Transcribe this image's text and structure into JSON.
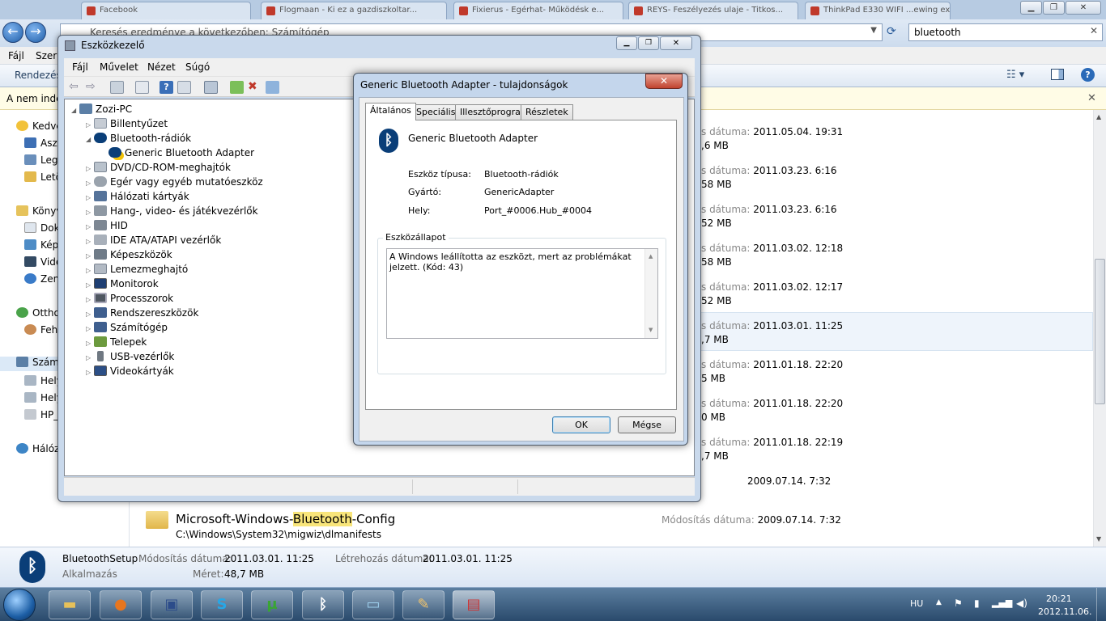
{
  "browser_tabs": [
    "Facebook",
    "Flogmaan - Ki ez a gazdiszkoltar...",
    "Fixierus - Egérhat- Működésk e...",
    "REYS- Feszélyezés ulaje - Titkos...",
    "ThinkPad E330 WIFI ...ewing ex..."
  ],
  "explorer": {
    "address": "Keresés eredménye a következőben: Számítógép",
    "search_value": "bluetooth",
    "menu": [
      "Fájl",
      "Szerk"
    ],
    "organize_label": "Rendezés",
    "infobar_text": "A nem inde",
    "nav_items": [
      "Kedve",
      "Aszt",
      "Leg",
      "Letö",
      "Könyv",
      "Dok",
      "Kép",
      "Vide",
      "Zen",
      "Ottho",
      "Feh",
      "Számí",
      "Hely",
      "Hely",
      "HP_",
      "Hálóz"
    ],
    "results": [
      {
        "date": "2011.05.04. 19:31",
        "size": ",6 MB"
      },
      {
        "date": "2011.03.23. 6:16",
        "size": "58 MB"
      },
      {
        "date": "2011.03.23. 6:16",
        "size": "52 MB"
      },
      {
        "date": "2011.03.02. 12:18",
        "size": "58 MB"
      },
      {
        "date": "2011.03.02. 12:17",
        "size": "52 MB"
      },
      {
        "date": "2011.03.01. 11:25",
        "size": ",7 MB"
      },
      {
        "date": "2011.01.18. 22:20",
        "size": "5 MB"
      },
      {
        "date": "2011.01.18. 22:20",
        "size": "0 MB"
      },
      {
        "date": "2011.01.18. 22:19",
        "size": ",7 MB"
      },
      {
        "date": "2009.07.14. 7:32",
        "size": ""
      }
    ],
    "date_label_short": "s dátuma:",
    "last_item": {
      "name_pre": "Microsoft-Windows-",
      "name_hl": "Bluetooth",
      "name_post": "-Config",
      "path": "C:\\Windows\\System32\\migwiz\\dlmanifests",
      "date_label": "Módosítás dátuma:",
      "date": "2009.07.14. 7:32"
    },
    "details": {
      "name": "BluetoothSetup",
      "type": "Alkalmazás",
      "mod_label": "Módosítás dátuma:",
      "mod_value": "2011.03.01. 11:25",
      "size_label": "Méret:",
      "size_value": "48,7 MB",
      "created_label": "Létrehozás dátuma:",
      "created_value": "2011.03.01. 11:25"
    }
  },
  "device_manager": {
    "title": "Eszközkezelő",
    "menu": [
      "Fájl",
      "Művelet",
      "Nézet",
      "Súgó"
    ],
    "root": "Zozi-PC",
    "tree": [
      {
        "label": "Billentyűzet",
        "level": 1,
        "expanded": false
      },
      {
        "label": "Bluetooth-rádiók",
        "level": 1,
        "expanded": true
      },
      {
        "label": "Generic Bluetooth Adapter",
        "level": 2,
        "expanded": false
      },
      {
        "label": "DVD/CD-ROM-meghajtók",
        "level": 1,
        "expanded": false
      },
      {
        "label": "Egér vagy egyéb mutatóeszköz",
        "level": 1,
        "expanded": false
      },
      {
        "label": "Hálózati kártyák",
        "level": 1,
        "expanded": false
      },
      {
        "label": "Hang-, video- és játékvezérlők",
        "level": 1,
        "expanded": false
      },
      {
        "label": "HID",
        "level": 1,
        "expanded": false
      },
      {
        "label": "IDE ATA/ATAPI vezérlők",
        "level": 1,
        "expanded": false
      },
      {
        "label": "Képeszközök",
        "level": 1,
        "expanded": false
      },
      {
        "label": "Lemezmeghajtó",
        "level": 1,
        "expanded": false
      },
      {
        "label": "Monitorok",
        "level": 1,
        "expanded": false
      },
      {
        "label": "Processzorok",
        "level": 1,
        "expanded": false
      },
      {
        "label": "Rendszereszközök",
        "level": 1,
        "expanded": false
      },
      {
        "label": "Számítógép",
        "level": 1,
        "expanded": false
      },
      {
        "label": "Telepek",
        "level": 1,
        "expanded": false
      },
      {
        "label": "USB-vezérlők",
        "level": 1,
        "expanded": false
      },
      {
        "label": "Videokártyák",
        "level": 1,
        "expanded": false
      }
    ]
  },
  "properties": {
    "title": "Generic Bluetooth Adapter - tulajdonságok",
    "tabs": [
      "Általános",
      "Speciális",
      "Illesztőprogram",
      "Részletek"
    ],
    "device_name": "Generic Bluetooth Adapter",
    "fields": [
      {
        "label": "Eszköz típusa:",
        "value": "Bluetooth-rádiók"
      },
      {
        "label": "Gyártó:",
        "value": "GenericAdapter"
      },
      {
        "label": "Hely:",
        "value": "Port_#0006.Hub_#0004"
      }
    ],
    "status_group": "Eszközállapot",
    "status_text": "A Windows leállította az eszközt, mert az problémákat jelzett. (Kód: 43)",
    "ok": "OK",
    "cancel": "Mégse"
  },
  "taskbar": {
    "lang": "HU",
    "time": "20:21",
    "date": "2012.11.06."
  }
}
